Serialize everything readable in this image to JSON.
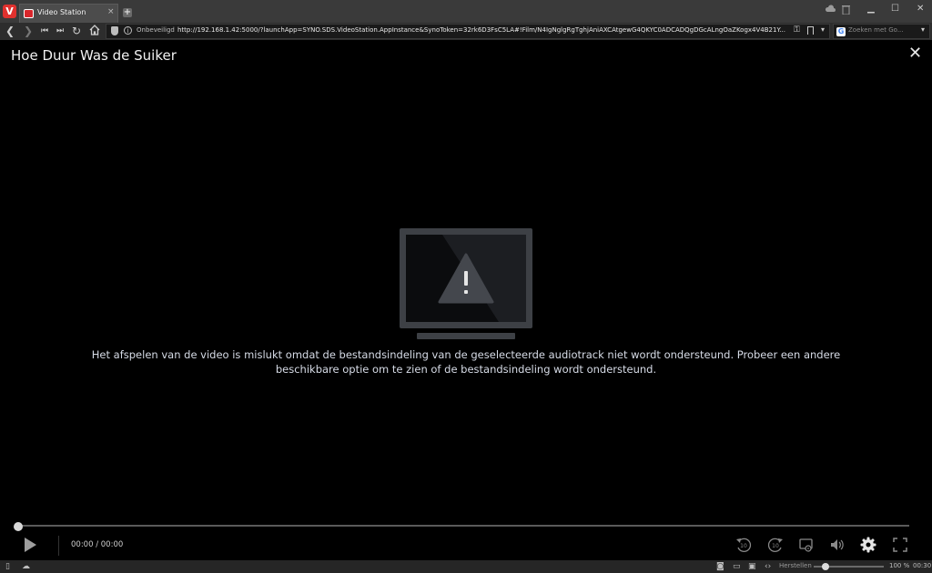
{
  "browser": {
    "tab_title": "Video Station",
    "tab_close": "×",
    "new_tab": "+",
    "security_label": "Onbeveiligd",
    "url": "http://192.168.1.42:5000/?launchApp=SYNO.SDS.VideoStation.AppInstance&SynoToken=32rk6D3FsC5LA#!Film/N4IgNglgRgTghjAniAXCAtgewG4QKYC0ADCADQgDGcALngOaZKogx4V4B21Y...",
    "search_placeholder": "Zoeken met Go...",
    "window_controls": [
      "▁",
      "☐",
      "✕"
    ]
  },
  "player": {
    "title": "Hoe Duur Was de Suiker",
    "close_label": "✕",
    "error_message": "Het afspelen van de video is mislukt omdat de bestandsindeling van de geselecteerde audiotrack niet wordt ondersteund. Probeer een andere beschikbare optie om te zien of de bestandsindeling wordt ondersteund.",
    "time": "00:00 / 00:00",
    "progress_fraction": 0,
    "rewind_label": "10",
    "forward_label": "10"
  },
  "statusbar": {
    "reset_label": "Herstellen",
    "zoom_label": "100 %",
    "clock": "00:30",
    "zoom_fraction": 0.2
  },
  "colors": {
    "background": "#000000",
    "chrome": "#2d2d2d",
    "accent_red": "#e0312e"
  },
  "icons": [
    "vivaldi-logo",
    "back-icon",
    "forward-icon",
    "rewind-icon",
    "fast-forward-icon",
    "reload-icon",
    "home-icon",
    "shield-icon",
    "info-icon",
    "key-icon",
    "bookmark-icon",
    "google-icon",
    "close-icon",
    "warning-icon",
    "play-icon",
    "rewind-10-icon",
    "forward-10-icon",
    "cast-icon",
    "volume-icon",
    "settings-icon",
    "fullscreen-icon",
    "panel-icon",
    "cloud-icon",
    "camera-icon",
    "window-icon",
    "image-icon",
    "code-icon"
  ]
}
